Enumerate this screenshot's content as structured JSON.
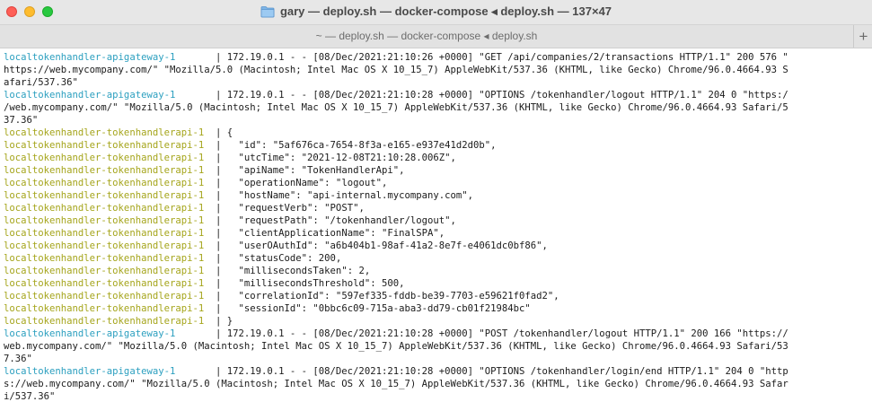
{
  "window": {
    "title": "gary — deploy.sh — docker-compose ◂ deploy.sh — 137×47",
    "tab_title": "~ — deploy.sh — docker-compose ◂ deploy.sh",
    "new_tab_label": "+"
  },
  "colors": {
    "gateway_prefix": "#2b9fbf",
    "api_prefix": "#a5a51b",
    "text": "#1b1b1b",
    "close": "#fe5f57",
    "minimize": "#febc2e",
    "maximize": "#28c840"
  },
  "icons": {
    "title_icon": "folder-icon"
  },
  "terminal": {
    "lines": [
      {
        "prefix": "localtokenhandler-apigateway-1      ",
        "type": "gw",
        "text": " | 172.19.0.1 - - [08/Dec/2021:21:10:26 +0000] \"GET /api/companies/2/transactions HTTP/1.1\" 200 576 \""
      },
      {
        "prefix": "",
        "type": "plain",
        "text": "https://web.mycompany.com/\" \"Mozilla/5.0 (Macintosh; Intel Mac OS X 10_15_7) AppleWebKit/537.36 (KHTML, like Gecko) Chrome/96.0.4664.93 S"
      },
      {
        "prefix": "",
        "type": "plain",
        "text": "afari/537.36\""
      },
      {
        "prefix": "localtokenhandler-apigateway-1      ",
        "type": "gw",
        "text": " | 172.19.0.1 - - [08/Dec/2021:21:10:28 +0000] \"OPTIONS /tokenhandler/logout HTTP/1.1\" 204 0 \"https:/"
      },
      {
        "prefix": "",
        "type": "plain",
        "text": "/web.mycompany.com/\" \"Mozilla/5.0 (Macintosh; Intel Mac OS X 10_15_7) AppleWebKit/537.36 (KHTML, like Gecko) Chrome/96.0.4664.93 Safari/5"
      },
      {
        "prefix": "",
        "type": "plain",
        "text": "37.36\""
      },
      {
        "prefix": "localtokenhandler-tokenhandlerapi-1  ",
        "type": "api",
        "text": "| {"
      },
      {
        "prefix": "localtokenhandler-tokenhandlerapi-1  ",
        "type": "api",
        "text": "|   \"id\": \"5af676ca-7654-8f3a-e165-e937e41d2d0b\","
      },
      {
        "prefix": "localtokenhandler-tokenhandlerapi-1  ",
        "type": "api",
        "text": "|   \"utcTime\": \"2021-12-08T21:10:28.006Z\","
      },
      {
        "prefix": "localtokenhandler-tokenhandlerapi-1  ",
        "type": "api",
        "text": "|   \"apiName\": \"TokenHandlerApi\","
      },
      {
        "prefix": "localtokenhandler-tokenhandlerapi-1  ",
        "type": "api",
        "text": "|   \"operationName\": \"logout\","
      },
      {
        "prefix": "localtokenhandler-tokenhandlerapi-1  ",
        "type": "api",
        "text": "|   \"hostName\": \"api-internal.mycompany.com\","
      },
      {
        "prefix": "localtokenhandler-tokenhandlerapi-1  ",
        "type": "api",
        "text": "|   \"requestVerb\": \"POST\","
      },
      {
        "prefix": "localtokenhandler-tokenhandlerapi-1  ",
        "type": "api",
        "text": "|   \"requestPath\": \"/tokenhandler/logout\","
      },
      {
        "prefix": "localtokenhandler-tokenhandlerapi-1  ",
        "type": "api",
        "text": "|   \"clientApplicationName\": \"FinalSPA\","
      },
      {
        "prefix": "localtokenhandler-tokenhandlerapi-1  ",
        "type": "api",
        "text": "|   \"userOAuthId\": \"a6b404b1-98af-41a2-8e7f-e4061dc0bf86\","
      },
      {
        "prefix": "localtokenhandler-tokenhandlerapi-1  ",
        "type": "api",
        "text": "|   \"statusCode\": 200,"
      },
      {
        "prefix": "localtokenhandler-tokenhandlerapi-1  ",
        "type": "api",
        "text": "|   \"millisecondsTaken\": 2,"
      },
      {
        "prefix": "localtokenhandler-tokenhandlerapi-1  ",
        "type": "api",
        "text": "|   \"millisecondsThreshold\": 500,"
      },
      {
        "prefix": "localtokenhandler-tokenhandlerapi-1  ",
        "type": "api",
        "text": "|   \"correlationId\": \"597ef335-fddb-be39-7703-e59621f0fad2\","
      },
      {
        "prefix": "localtokenhandler-tokenhandlerapi-1  ",
        "type": "api",
        "text": "|   \"sessionId\": \"0bbc6c09-715a-aba3-dd79-cb01f21984bc\""
      },
      {
        "prefix": "localtokenhandler-tokenhandlerapi-1  ",
        "type": "api",
        "text": "| }"
      },
      {
        "prefix": "localtokenhandler-apigateway-1      ",
        "type": "gw",
        "text": " | 172.19.0.1 - - [08/Dec/2021:21:10:28 +0000] \"POST /tokenhandler/logout HTTP/1.1\" 200 166 \"https://"
      },
      {
        "prefix": "",
        "type": "plain",
        "text": "web.mycompany.com/\" \"Mozilla/5.0 (Macintosh; Intel Mac OS X 10_15_7) AppleWebKit/537.36 (KHTML, like Gecko) Chrome/96.0.4664.93 Safari/53"
      },
      {
        "prefix": "",
        "type": "plain",
        "text": "7.36\""
      },
      {
        "prefix": "localtokenhandler-apigateway-1      ",
        "type": "gw",
        "text": " | 172.19.0.1 - - [08/Dec/2021:21:10:28 +0000] \"OPTIONS /tokenhandler/login/end HTTP/1.1\" 204 0 \"http"
      },
      {
        "prefix": "",
        "type": "plain",
        "text": "s://web.mycompany.com/\" \"Mozilla/5.0 (Macintosh; Intel Mac OS X 10_15_7) AppleWebKit/537.36 (KHTML, like Gecko) Chrome/96.0.4664.93 Safar"
      },
      {
        "prefix": "",
        "type": "plain",
        "text": "i/537.36\""
      }
    ]
  }
}
